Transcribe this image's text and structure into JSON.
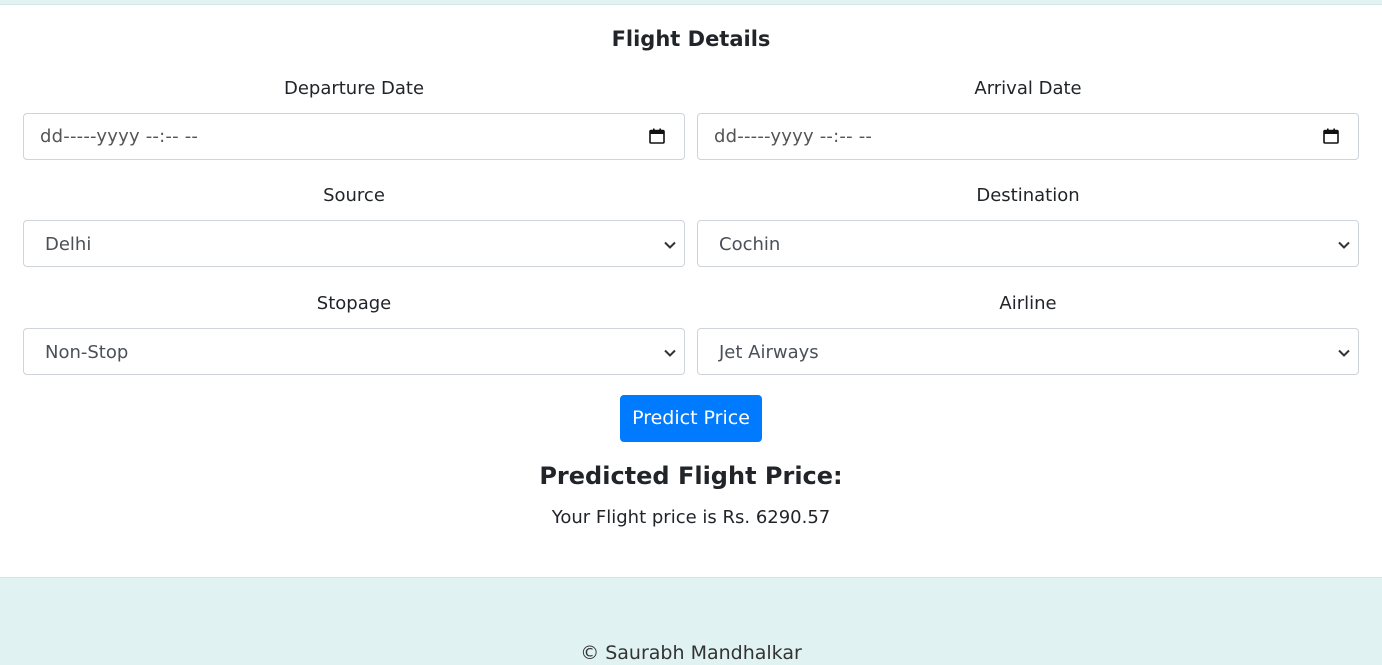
{
  "form": {
    "title": "Flight Details",
    "departure": {
      "label": "Departure Date",
      "placeholder": "dd-----yyyy --:-- --"
    },
    "arrival": {
      "label": "Arrival Date",
      "placeholder": "dd-----yyyy --:-- --"
    },
    "source": {
      "label": "Source",
      "selected": "Delhi"
    },
    "destination": {
      "label": "Destination",
      "selected": "Cochin"
    },
    "stopage": {
      "label": "Stopage",
      "selected": "Non-Stop"
    },
    "airline": {
      "label": "Airline",
      "selected": "Jet Airways"
    },
    "submit_label": "Predict Price"
  },
  "result": {
    "heading": "Predicted Flight Price:",
    "text": "Your Flight price is Rs. 6290.57"
  },
  "footer": {
    "text": "© Saurabh Mandhalkar"
  },
  "colors": {
    "accent": "#007bff",
    "footer_bg": "#e0f2f1"
  },
  "icons": {
    "date": "calendar-icon",
    "select": "chevron-down-icon"
  }
}
